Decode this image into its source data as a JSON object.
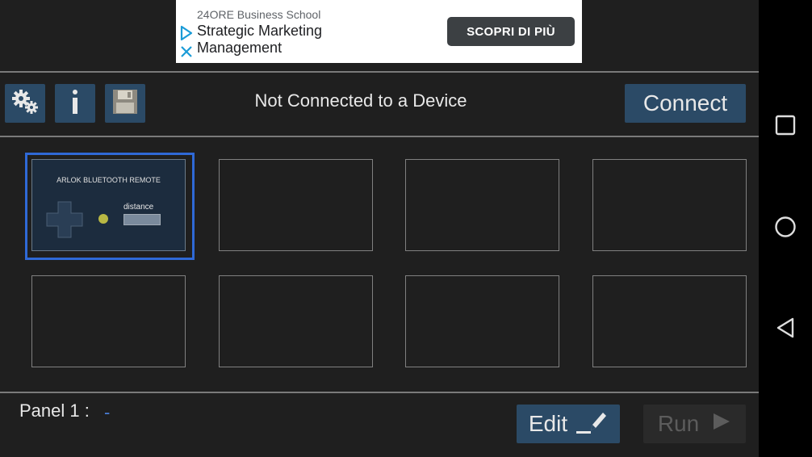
{
  "ad": {
    "advertiser": "24ORE Business School",
    "title": "Strategic Marketing Management",
    "cta": "SCOPRI DI PIÙ"
  },
  "toolbar": {
    "settings_icon": "gears-icon",
    "info_icon": "info-icon",
    "save_icon": "floppy-disk-icon",
    "status": "Not Connected to a Device",
    "connect_label": "Connect"
  },
  "panels": [
    {
      "title": "ARLOK BLUETOOTH REMOTE",
      "distance_label": "distance",
      "selected": true
    },
    {
      "title": ""
    },
    {
      "title": ""
    },
    {
      "title": ""
    },
    {
      "title": ""
    },
    {
      "title": ""
    },
    {
      "title": ""
    },
    {
      "title": ""
    }
  ],
  "footer": {
    "panel_label": "Panel 1 :",
    "panel_name": "-",
    "edit_label": "Edit",
    "run_label": "Run"
  },
  "colors": {
    "button_bg": "#2b4a66",
    "selected_border": "#2f69d6",
    "panel_name": "#4a7fd8"
  },
  "nav": {
    "icons": [
      "recents-square-icon",
      "home-circle-icon",
      "back-triangle-icon"
    ]
  }
}
